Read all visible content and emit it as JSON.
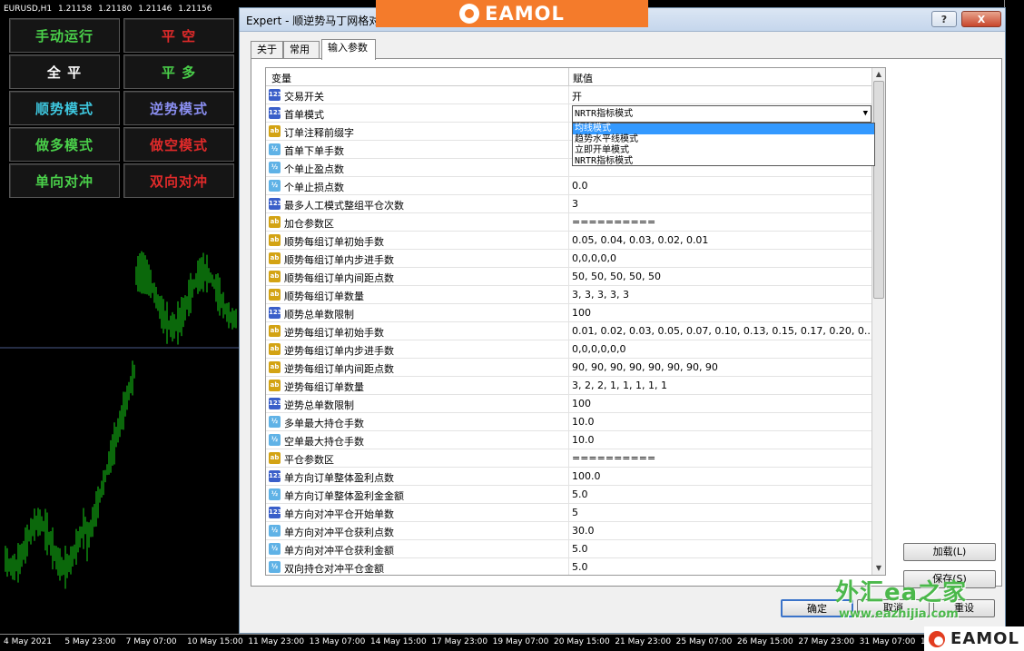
{
  "chart": {
    "symbol": "EURUSD,H1",
    "quotes": [
      "1.21158",
      "1.21180",
      "1.21146",
      "1.21156"
    ],
    "time_ticks": [
      "4 May 2021",
      "5 May 23:00",
      "7 May 07:00",
      "10 May 15:00",
      "11 May 23:00",
      "13 May 07:00",
      "14 May 15:00",
      "17 May 23:00",
      "19 May 07:00",
      "20 May 15:00",
      "21 May 23:00",
      "25 May 07:00",
      "26 May 15:00",
      "27 May 23:00",
      "31 May 07:00",
      "1 Jun 15:00"
    ],
    "candle_color": "#16d016"
  },
  "panel": {
    "buttons": [
      {
        "label": "手动运行",
        "color": "#4ad04a"
      },
      {
        "label": "平  空",
        "color": "#e02a2a"
      },
      {
        "label": "全  平",
        "color": "#ffffff"
      },
      {
        "label": "平  多",
        "color": "#4ad04a"
      },
      {
        "label": "顺势模式",
        "color": "#3ec8e0"
      },
      {
        "label": "逆势模式",
        "color": "#8a8ef0"
      },
      {
        "label": "做多模式",
        "color": "#4ad04a"
      },
      {
        "label": "做空模式",
        "color": "#e02a2a"
      },
      {
        "label": "单向对冲",
        "color": "#4ad04a"
      },
      {
        "label": "双向对冲",
        "color": "#e02a2a"
      }
    ]
  },
  "dialog": {
    "title": "Expert - 顺逆势马丁网格对",
    "titlebar_buttons": [
      "?",
      "X"
    ],
    "tabs": [
      "关于",
      "常用",
      "输入参数"
    ],
    "active_tab": "输入参数",
    "grid": {
      "col_variable": "变量",
      "col_value": "赋值",
      "rows": [
        {
          "type": "int",
          "name": "交易开关",
          "value": "开"
        },
        {
          "type": "int",
          "name": "首单模式",
          "value": ""
        },
        {
          "type": "str",
          "name": "订单注释前缀字",
          "value": ""
        },
        {
          "type": "dbl",
          "name": "首单下单手数",
          "value": ""
        },
        {
          "type": "dbl",
          "name": "个单止盈点数",
          "value": ""
        },
        {
          "type": "dbl",
          "name": "个单止损点数",
          "value": "0.0"
        },
        {
          "type": "int",
          "name": "最多人工模式整组平仓次数",
          "value": "3"
        },
        {
          "type": "str",
          "name": "加仓参数区",
          "value": "=========="
        },
        {
          "type": "str",
          "name": "顺势每组订单初始手数",
          "value": "0.05, 0.04, 0.03, 0.02, 0.01"
        },
        {
          "type": "str",
          "name": "顺势每组订单内步进手数",
          "value": "0,0,0,0,0"
        },
        {
          "type": "str",
          "name": "顺势每组订单内间距点数",
          "value": "50, 50, 50, 50, 50"
        },
        {
          "type": "str",
          "name": "顺势每组订单数量",
          "value": "3, 3, 3, 3, 3"
        },
        {
          "type": "int",
          "name": "顺势总单数限制",
          "value": "100"
        },
        {
          "type": "str",
          "name": "逆势每组订单初始手数",
          "value": "0.01, 0.02, 0.03, 0.05, 0.07, 0.10, 0.13, 0.15, 0.17, 0.20, 0..."
        },
        {
          "type": "str",
          "name": "逆势每组订单内步进手数",
          "value": "0,0,0,0,0,0"
        },
        {
          "type": "str",
          "name": "逆势每组订单内间距点数",
          "value": "90, 90, 90, 90, 90, 90, 90, 90"
        },
        {
          "type": "str",
          "name": "逆势每组订单数量",
          "value": "3, 2, 2, 1, 1, 1, 1, 1"
        },
        {
          "type": "int",
          "name": "逆势总单数限制",
          "value": "100"
        },
        {
          "type": "dbl",
          "name": "多单最大持仓手数",
          "value": "10.0"
        },
        {
          "type": "dbl",
          "name": "空单最大持仓手数",
          "value": "10.0"
        },
        {
          "type": "str",
          "name": "平仓参数区",
          "value": "=========="
        },
        {
          "type": "int",
          "name": "单方向订单整体盈利点数",
          "value": "100.0"
        },
        {
          "type": "dbl",
          "name": "单方向订单整体盈利金金额",
          "value": "5.0"
        },
        {
          "type": "int",
          "name": "单方向对冲平仓开始单数",
          "value": "5"
        },
        {
          "type": "dbl",
          "name": "单方向对冲平仓获利点数",
          "value": "30.0"
        },
        {
          "type": "dbl",
          "name": "单方向对冲平仓获利金额",
          "value": "5.0"
        },
        {
          "type": "dbl",
          "name": "双向持仓对冲平仓金额",
          "value": "5.0"
        }
      ]
    },
    "dropdown": {
      "selected": "NRTR指标模式",
      "options": [
        "均线模式",
        "趋势水平线模式",
        "立即开单模式",
        "NRTR指标模式"
      ],
      "highlighted": "均线模式"
    },
    "side_buttons": {
      "load": "加载(L)",
      "save": "保存(S)"
    },
    "bottom_buttons": {
      "ok": "确定",
      "cancel": "取消",
      "reset": "重设"
    }
  },
  "branding": {
    "eamol": "EAMOL",
    "watermark_line1": "外汇ea之家",
    "watermark_line2": "www.eazhijia.com"
  }
}
